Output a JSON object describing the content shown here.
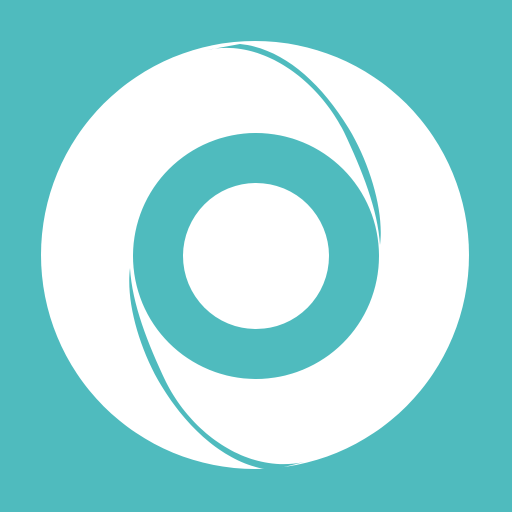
{
  "icon": {
    "name": "circular-swirl-logo",
    "colors": {
      "background": "#4FBBBE",
      "foreground": "#FFFFFF"
    }
  }
}
